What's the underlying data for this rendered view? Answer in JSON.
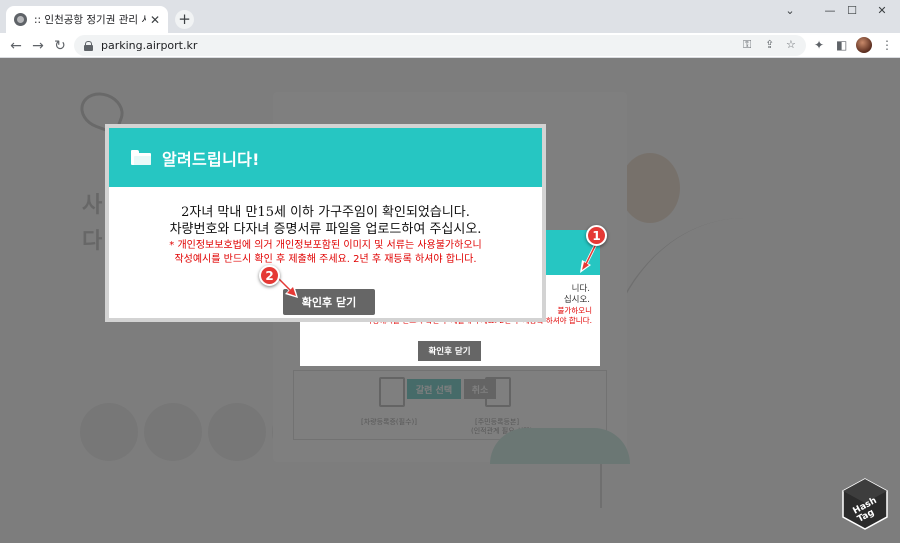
{
  "browser": {
    "tab_title": ":: 인천공항 정기권 관리 시스템 ::",
    "tab_close": "✕",
    "new_tab": "+",
    "window_controls": {
      "collapse": "⌄",
      "minimize": "—",
      "maximize": "☐",
      "close": "✕"
    },
    "nav": {
      "back": "←",
      "forward": "→",
      "reload": "↻"
    },
    "url": "parking.airport.kr",
    "omnibox_icons": {
      "key": "⚿",
      "share": "⇪",
      "bookmark": "☆"
    },
    "toolbar_icons": {
      "extensions": "✦",
      "sidepanel": "◧",
      "menu": "⋮"
    }
  },
  "dialog": {
    "title": "알려드립니다!",
    "message_line1": "2자녀 막내 만15세 이하 가구주임이 확인되었습니다.",
    "message_line2": "차량번호와 다자녀 증명서류 파일을 업로드하여 주십시오.",
    "warning_line1": "* 개인정보보호법에 의거 개인정보포함된 이미지 및 서류는 사용불가하오니",
    "warning_line2": "작성예시를 반드시 확인 후 제출해 주세요. 2년 후 재등록 하셔야 합니다.",
    "button": "확인후 닫기"
  },
  "dialog_behind": {
    "text_line1": "니다.",
    "text_line2": "십시오.",
    "warning_line1": "불가하오니",
    "warning_line2": "작성예시를 반드시 확인 후 제출해 주세요. 2년 후 재등록 하셔야 합니다.",
    "button": "확인후 닫기"
  },
  "background_page": {
    "upload_label1": "[차량등록증(필수)]",
    "upload_label2": "[주민등록등본]",
    "upload_label3": "(인적관계 필요 선택)",
    "btn_select": "갈련 선택",
    "btn_cancel": "취소"
  },
  "markers": {
    "m1": "1",
    "m2": "2"
  },
  "watermark": {
    "line1": "Hash",
    "line2": "Tag"
  },
  "colors": {
    "accent": "#26c6c2",
    "button": "#666666",
    "warning": "#e00000",
    "marker": "#e53935"
  }
}
